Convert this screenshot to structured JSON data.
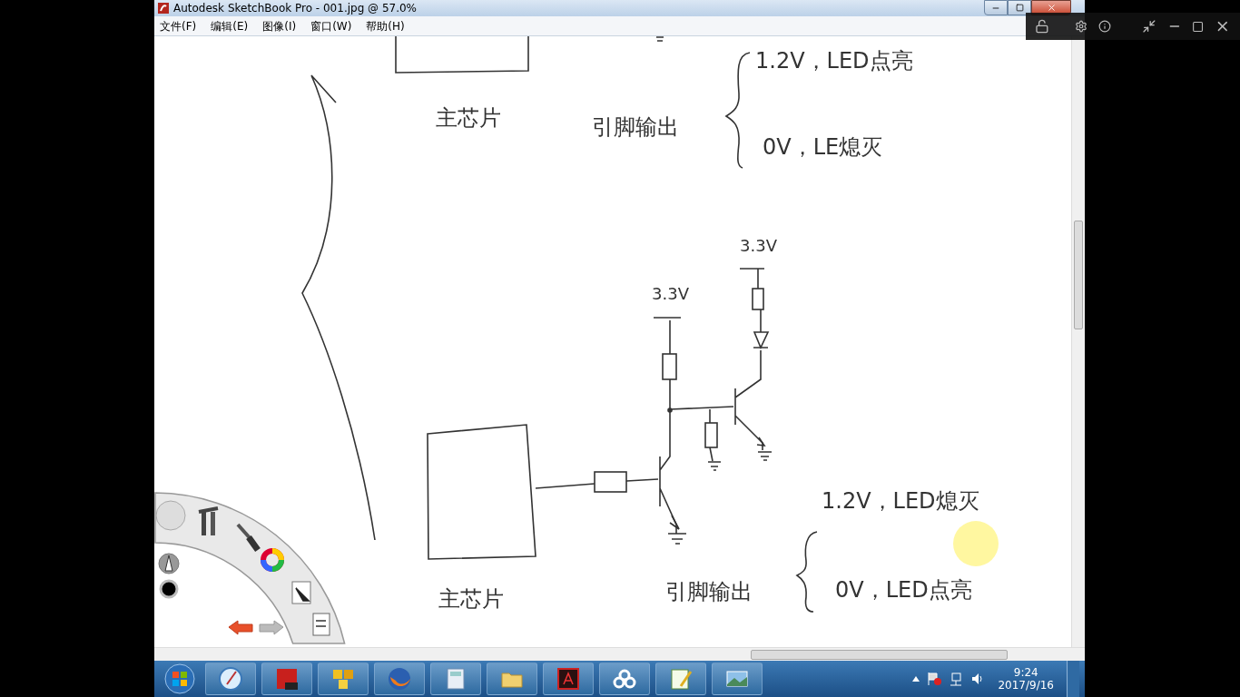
{
  "window": {
    "title": "Autodesk SketchBook Pro - 001.jpg @ 57.0%"
  },
  "menu": [
    "文件(F)",
    "编辑(E)",
    "图像(I)",
    "窗口(W)",
    "帮助(H)"
  ],
  "canvas": {
    "top_section": {
      "chip_label": "主芯片",
      "pin_label": "引脚输出",
      "states": [
        "1.2V，LED点亮",
        "0V，LE熄灭"
      ]
    },
    "bottom_section": {
      "supply_labels": [
        "3.3V",
        "3.3V"
      ],
      "chip_label": "主芯片",
      "pin_label": "引脚输出",
      "states": [
        "1.2V，LED熄灭",
        "0V，LED点亮"
      ]
    }
  },
  "taskbar": {
    "clock": {
      "time": "9:24",
      "date": "2017/9/16"
    }
  }
}
